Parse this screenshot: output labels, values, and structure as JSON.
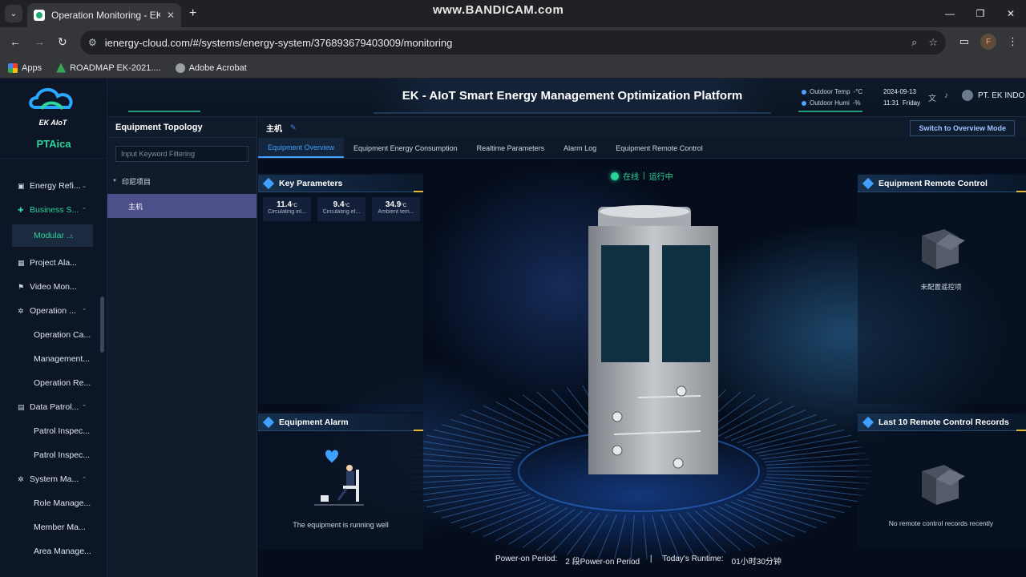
{
  "browser": {
    "tab_title": "Operation Monitoring - EK-AIoT",
    "url": "ienergy-cloud.com/#/systems/energy-system/376893679403009/monitoring",
    "watermark": "www.BANDICAM.com",
    "profile_initial": "F",
    "bookmarks": [
      "Apps",
      "ROADMAP EK-2021....",
      "Adobe Acrobat"
    ]
  },
  "header": {
    "platform_title": "EK - AIoT  Smart Energy Management Optimization Platform",
    "outdoor_temp_label": "Outdoor Temp",
    "outdoor_temp_value": "-°C",
    "outdoor_humi_label": "Outdoor Humi",
    "outdoor_humi_value": "-%",
    "date": "2024-09-13",
    "time": "11:31",
    "weekday": "Friday",
    "user": "PT. EK INDO"
  },
  "sidebar": {
    "logo_text": "EK AIoT",
    "project": "PTAica",
    "items": [
      {
        "label": "Energy Refi...",
        "chev": "⌄",
        "kind": "top",
        "icon": "▣"
      },
      {
        "label": "Business S...",
        "chev": "⌃",
        "kind": "top green",
        "icon": "✚"
      },
      {
        "label": "Modular ...",
        "chev": "›",
        "kind": "active",
        "icon": ""
      },
      {
        "label": "Project Ala...",
        "chev": "",
        "kind": "top",
        "icon": "▦"
      },
      {
        "label": "Video Mon...",
        "chev": "",
        "kind": "top",
        "icon": "⚑"
      },
      {
        "label": "Operation ...",
        "chev": "⌃",
        "kind": "top",
        "icon": "✲"
      },
      {
        "label": "Operation Ca...",
        "chev": "",
        "kind": "sub",
        "icon": ""
      },
      {
        "label": "Management...",
        "chev": "",
        "kind": "sub",
        "icon": ""
      },
      {
        "label": "Operation Re...",
        "chev": "",
        "kind": "sub",
        "icon": ""
      },
      {
        "label": "Data Patrol...",
        "chev": "⌃",
        "kind": "top",
        "icon": "▤"
      },
      {
        "label": "Patrol Inspec...",
        "chev": "",
        "kind": "sub",
        "icon": ""
      },
      {
        "label": "Patrol Inspec...",
        "chev": "",
        "kind": "sub",
        "icon": ""
      },
      {
        "label": "System Ma...",
        "chev": "⌃",
        "kind": "top",
        "icon": "✲"
      },
      {
        "label": "Role Manage...",
        "chev": "",
        "kind": "sub",
        "icon": ""
      },
      {
        "label": "Member Ma...",
        "chev": "",
        "kind": "sub",
        "icon": ""
      },
      {
        "label": "Area Manage...",
        "chev": "",
        "kind": "sub",
        "icon": ""
      }
    ]
  },
  "topology": {
    "title": "Equipment Topology",
    "search_placeholder": "Input Keyword Filtering",
    "root": "印尼项目",
    "child": "主机"
  },
  "main": {
    "device_name": "主机",
    "overview_button": "Switch to Overview Mode",
    "tabs": [
      "Equipment Overview",
      "Equipment Energy Consumption",
      "Realtime Parameters",
      "Alarm Log",
      "Equipment Remote Control"
    ],
    "status_online": "在线",
    "status_running": "运行中",
    "key_params_title": "Key Parameters",
    "key_params": [
      {
        "value": "11.4",
        "unit": "°C",
        "label": "Circulating inl..."
      },
      {
        "value": "9.4",
        "unit": "°C",
        "label": "Circulating ef..."
      },
      {
        "value": "34.9",
        "unit": "°C",
        "label": "Ambient tem..."
      }
    ],
    "alarm_title": "Equipment Alarm",
    "alarm_text": "The equipment is running well",
    "remote_title": "Equipment Remote Control",
    "remote_empty": "未配置遥控项",
    "records_title": "Last 10 Remote Control Records",
    "records_empty": "No remote control records recently",
    "power_on_label": "Power-on Period:",
    "power_on_value": "2 段Power-on Period",
    "runtime_label": "Today's Runtime:",
    "runtime_value": "01小时30分钟"
  }
}
